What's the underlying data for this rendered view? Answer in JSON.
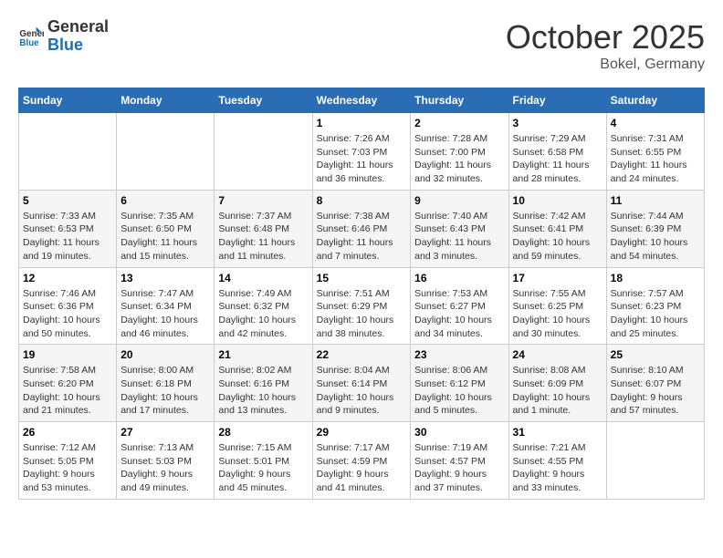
{
  "logo": {
    "line1": "General",
    "line2": "Blue"
  },
  "title": "October 2025",
  "subtitle": "Bokel, Germany",
  "days_of_week": [
    "Sunday",
    "Monday",
    "Tuesday",
    "Wednesday",
    "Thursday",
    "Friday",
    "Saturday"
  ],
  "weeks": [
    [
      {
        "num": "",
        "info": ""
      },
      {
        "num": "",
        "info": ""
      },
      {
        "num": "",
        "info": ""
      },
      {
        "num": "1",
        "info": "Sunrise: 7:26 AM\nSunset: 7:03 PM\nDaylight: 11 hours\nand 36 minutes."
      },
      {
        "num": "2",
        "info": "Sunrise: 7:28 AM\nSunset: 7:00 PM\nDaylight: 11 hours\nand 32 minutes."
      },
      {
        "num": "3",
        "info": "Sunrise: 7:29 AM\nSunset: 6:58 PM\nDaylight: 11 hours\nand 28 minutes."
      },
      {
        "num": "4",
        "info": "Sunrise: 7:31 AM\nSunset: 6:55 PM\nDaylight: 11 hours\nand 24 minutes."
      }
    ],
    [
      {
        "num": "5",
        "info": "Sunrise: 7:33 AM\nSunset: 6:53 PM\nDaylight: 11 hours\nand 19 minutes."
      },
      {
        "num": "6",
        "info": "Sunrise: 7:35 AM\nSunset: 6:50 PM\nDaylight: 11 hours\nand 15 minutes."
      },
      {
        "num": "7",
        "info": "Sunrise: 7:37 AM\nSunset: 6:48 PM\nDaylight: 11 hours\nand 11 minutes."
      },
      {
        "num": "8",
        "info": "Sunrise: 7:38 AM\nSunset: 6:46 PM\nDaylight: 11 hours\nand 7 minutes."
      },
      {
        "num": "9",
        "info": "Sunrise: 7:40 AM\nSunset: 6:43 PM\nDaylight: 11 hours\nand 3 minutes."
      },
      {
        "num": "10",
        "info": "Sunrise: 7:42 AM\nSunset: 6:41 PM\nDaylight: 10 hours\nand 59 minutes."
      },
      {
        "num": "11",
        "info": "Sunrise: 7:44 AM\nSunset: 6:39 PM\nDaylight: 10 hours\nand 54 minutes."
      }
    ],
    [
      {
        "num": "12",
        "info": "Sunrise: 7:46 AM\nSunset: 6:36 PM\nDaylight: 10 hours\nand 50 minutes."
      },
      {
        "num": "13",
        "info": "Sunrise: 7:47 AM\nSunset: 6:34 PM\nDaylight: 10 hours\nand 46 minutes."
      },
      {
        "num": "14",
        "info": "Sunrise: 7:49 AM\nSunset: 6:32 PM\nDaylight: 10 hours\nand 42 minutes."
      },
      {
        "num": "15",
        "info": "Sunrise: 7:51 AM\nSunset: 6:29 PM\nDaylight: 10 hours\nand 38 minutes."
      },
      {
        "num": "16",
        "info": "Sunrise: 7:53 AM\nSunset: 6:27 PM\nDaylight: 10 hours\nand 34 minutes."
      },
      {
        "num": "17",
        "info": "Sunrise: 7:55 AM\nSunset: 6:25 PM\nDaylight: 10 hours\nand 30 minutes."
      },
      {
        "num": "18",
        "info": "Sunrise: 7:57 AM\nSunset: 6:23 PM\nDaylight: 10 hours\nand 25 minutes."
      }
    ],
    [
      {
        "num": "19",
        "info": "Sunrise: 7:58 AM\nSunset: 6:20 PM\nDaylight: 10 hours\nand 21 minutes."
      },
      {
        "num": "20",
        "info": "Sunrise: 8:00 AM\nSunset: 6:18 PM\nDaylight: 10 hours\nand 17 minutes."
      },
      {
        "num": "21",
        "info": "Sunrise: 8:02 AM\nSunset: 6:16 PM\nDaylight: 10 hours\nand 13 minutes."
      },
      {
        "num": "22",
        "info": "Sunrise: 8:04 AM\nSunset: 6:14 PM\nDaylight: 10 hours\nand 9 minutes."
      },
      {
        "num": "23",
        "info": "Sunrise: 8:06 AM\nSunset: 6:12 PM\nDaylight: 10 hours\nand 5 minutes."
      },
      {
        "num": "24",
        "info": "Sunrise: 8:08 AM\nSunset: 6:09 PM\nDaylight: 10 hours\nand 1 minute."
      },
      {
        "num": "25",
        "info": "Sunrise: 8:10 AM\nSunset: 6:07 PM\nDaylight: 9 hours\nand 57 minutes."
      }
    ],
    [
      {
        "num": "26",
        "info": "Sunrise: 7:12 AM\nSunset: 5:05 PM\nDaylight: 9 hours\nand 53 minutes."
      },
      {
        "num": "27",
        "info": "Sunrise: 7:13 AM\nSunset: 5:03 PM\nDaylight: 9 hours\nand 49 minutes."
      },
      {
        "num": "28",
        "info": "Sunrise: 7:15 AM\nSunset: 5:01 PM\nDaylight: 9 hours\nand 45 minutes."
      },
      {
        "num": "29",
        "info": "Sunrise: 7:17 AM\nSunset: 4:59 PM\nDaylight: 9 hours\nand 41 minutes."
      },
      {
        "num": "30",
        "info": "Sunrise: 7:19 AM\nSunset: 4:57 PM\nDaylight: 9 hours\nand 37 minutes."
      },
      {
        "num": "31",
        "info": "Sunrise: 7:21 AM\nSunset: 4:55 PM\nDaylight: 9 hours\nand 33 minutes."
      },
      {
        "num": "",
        "info": ""
      }
    ]
  ]
}
